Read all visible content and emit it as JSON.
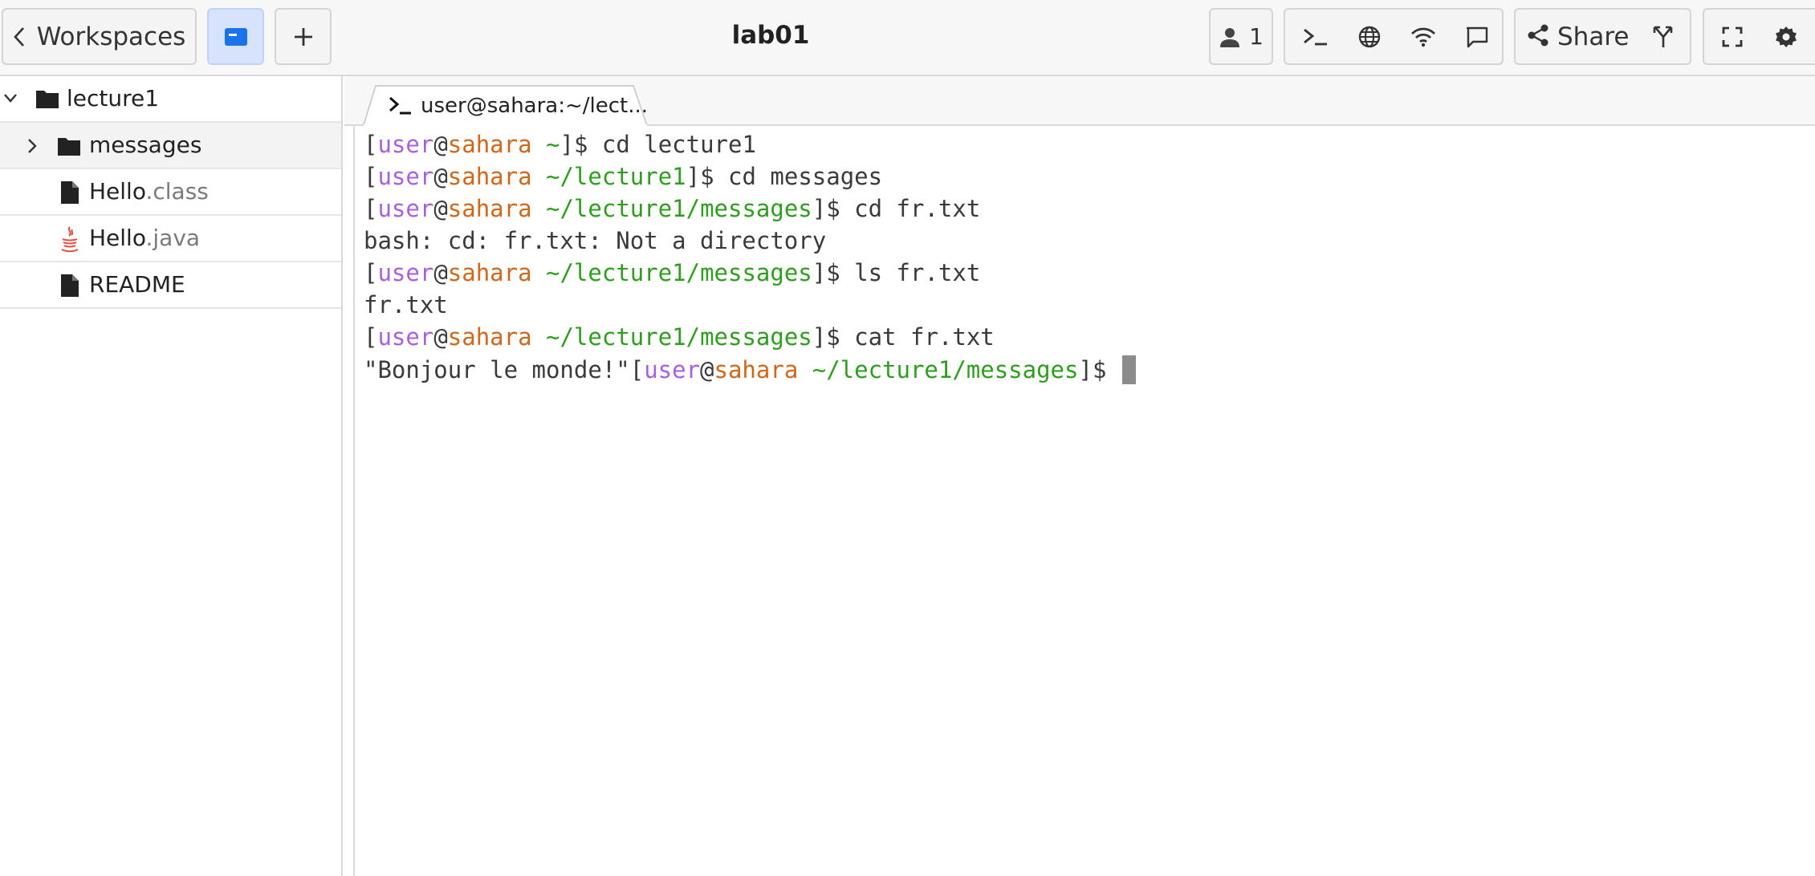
{
  "topbar": {
    "workspaces_label": "Workspaces",
    "title": "lab01",
    "users_count": "1",
    "share_label": "Share",
    "accent_color": "#1a73e8"
  },
  "sidebar": {
    "root": {
      "name": "lecture1",
      "icon": "folder-icon",
      "expanded": true
    },
    "items": [
      {
        "name": "messages",
        "ext": "",
        "icon": "folder-icon",
        "collapsed": true
      },
      {
        "name": "Hello",
        "ext": ".class",
        "icon": "file-icon"
      },
      {
        "name": "Hello",
        "ext": ".java",
        "icon": "java-icon"
      },
      {
        "name": "README",
        "ext": "",
        "icon": "file-icon"
      }
    ]
  },
  "terminal": {
    "tab_label": "user@sahara:~/lect...",
    "lines": [
      {
        "type": "prompt",
        "user": "user",
        "at": "@",
        "host": "sahara",
        "path": "~",
        "cmd": "cd lecture1"
      },
      {
        "type": "prompt",
        "user": "user",
        "at": "@",
        "host": "sahara",
        "path": "~/lecture1",
        "cmd": "cd messages"
      },
      {
        "type": "prompt",
        "user": "user",
        "at": "@",
        "host": "sahara",
        "path": "~/lecture1/messages",
        "cmd": "cd fr.txt"
      },
      {
        "type": "output",
        "text": "bash: cd: fr.txt: Not a directory"
      },
      {
        "type": "prompt",
        "user": "user",
        "at": "@",
        "host": "sahara",
        "path": "~/lecture1/messages",
        "cmd": "ls fr.txt"
      },
      {
        "type": "output",
        "text": "fr.txt"
      },
      {
        "type": "prompt",
        "user": "user",
        "at": "@",
        "host": "sahara",
        "path": "~/lecture1/messages",
        "cmd": "cat fr.txt"
      },
      {
        "type": "prompt_with_prefix",
        "prefix": "\"Bonjour le monde!\"",
        "user": "user",
        "at": "@",
        "host": "sahara",
        "path": "~/lecture1/messages",
        "cmd": ""
      }
    ],
    "colors": {
      "user": "#a661e0",
      "host": "#d0671a",
      "path": "#2e9e1e"
    }
  }
}
